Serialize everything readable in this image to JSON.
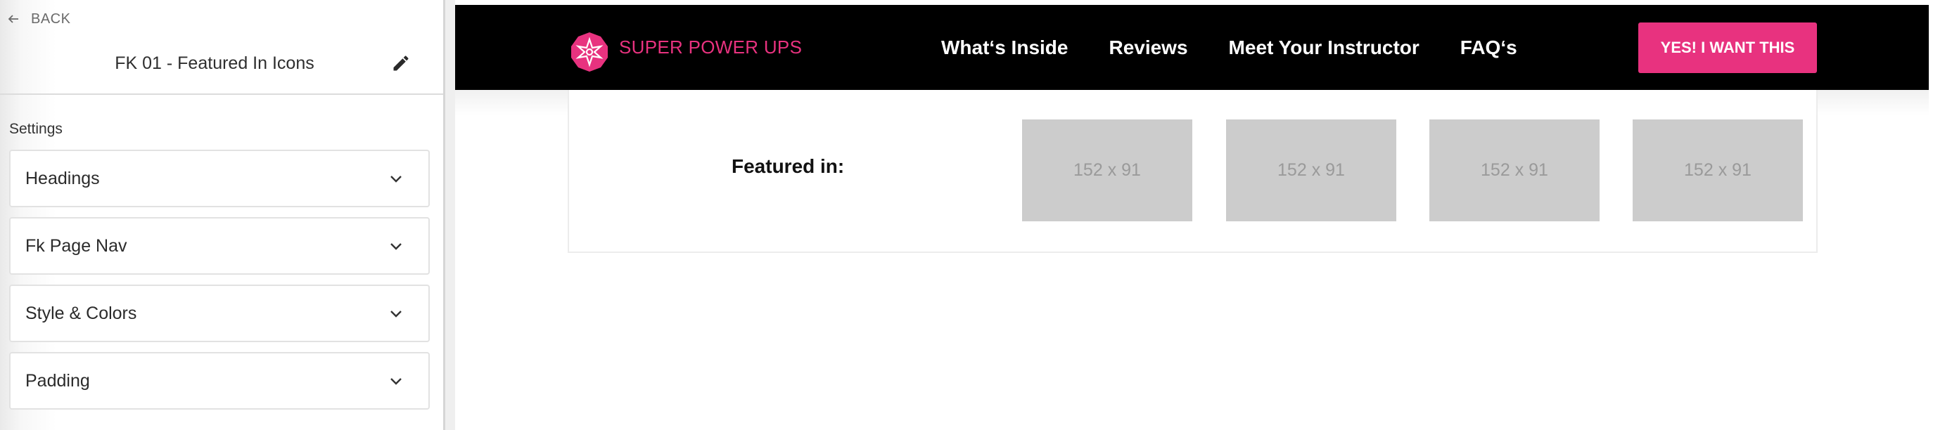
{
  "sidebar": {
    "back_label": "BACK",
    "title": "FK 01 - Featured In Icons",
    "settings_label": "Settings",
    "sections": [
      {
        "label": "Headings"
      },
      {
        "label": "Fk Page Nav"
      },
      {
        "label": "Style & Colors"
      },
      {
        "label": "Padding"
      }
    ]
  },
  "preview": {
    "brand": "SUPER POWER UPS",
    "brand_color": "#e8327f",
    "nav_links": [
      "What‘s Inside",
      "Reviews",
      "Meet Your Instructor",
      "FAQ‘s"
    ],
    "cta_label": "YES! I WANT THIS",
    "cta_color": "#e8327f",
    "featured_label": "Featured in:",
    "placeholders": [
      "152 x 91",
      "152 x 91",
      "152 x 91",
      "152 x 91"
    ]
  }
}
